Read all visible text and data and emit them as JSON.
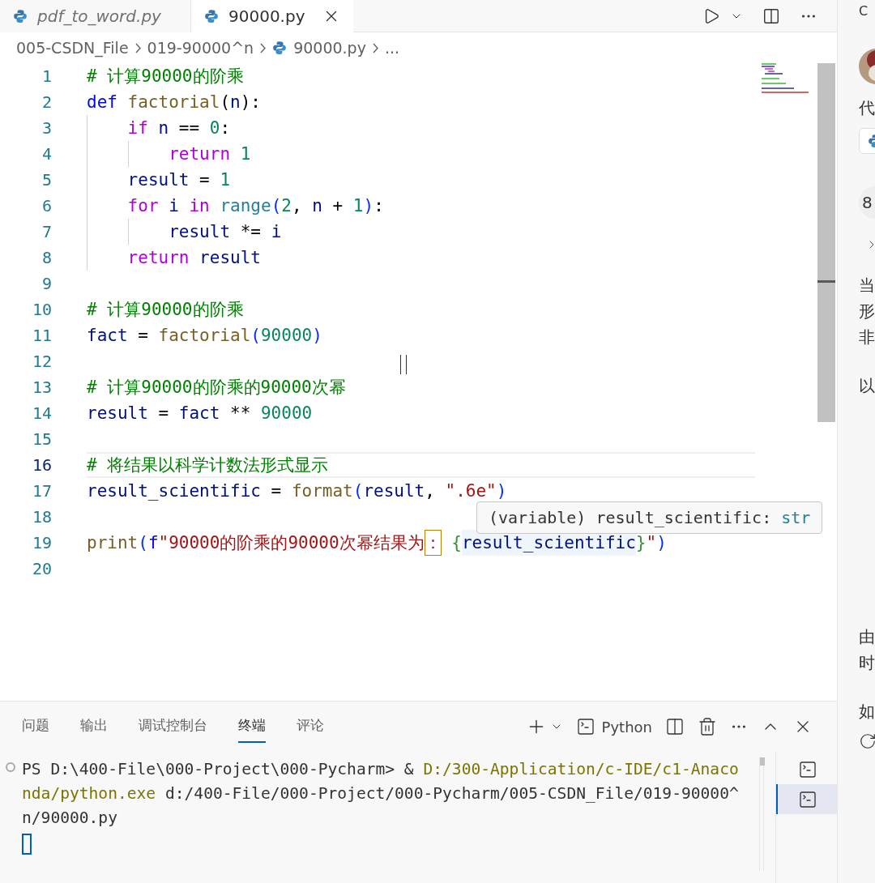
{
  "editor_tabs": [
    {
      "label": "pdf_to_word.py",
      "selected": false,
      "preview": true,
      "closable": false
    },
    {
      "label": "90000.py",
      "selected": true,
      "preview": false,
      "closable": true
    }
  ],
  "breadcrumbs": [
    {
      "label": "005-CSDN_File",
      "kind": "folder"
    },
    {
      "label": "019-90000^n",
      "kind": "folder"
    },
    {
      "label": "90000.py",
      "kind": "file"
    },
    {
      "label": "...",
      "kind": "more"
    }
  ],
  "code_lines": [
    {
      "number": "1",
      "current": false,
      "tokens": [
        {
          "kind": "comment",
          "text": "# 计算90000的阶乘"
        }
      ]
    },
    {
      "number": "2",
      "current": false,
      "tokens": [
        {
          "kind": "storage",
          "text": "def "
        },
        {
          "kind": "function",
          "text": "factorial"
        },
        {
          "kind": "plain",
          "text": "("
        },
        {
          "kind": "variable",
          "text": "n"
        },
        {
          "kind": "plain",
          "text": "):"
        }
      ]
    },
    {
      "number": "3",
      "current": false,
      "indent_guides": [
        {
          "visible": true
        }
      ],
      "tokens": [
        {
          "kind": "keyword",
          "text": "if "
        },
        {
          "kind": "variable",
          "text": "n"
        },
        {
          "kind": "plain",
          "text": " == "
        },
        {
          "kind": "number",
          "text": "0"
        },
        {
          "kind": "plain",
          "text": ":"
        }
      ]
    },
    {
      "number": "4",
      "current": false,
      "indent_guides": [
        {
          "visible": true
        },
        {
          "visible": true
        }
      ],
      "tokens": [
        {
          "kind": "keyword",
          "text": "return "
        },
        {
          "kind": "number",
          "text": "1"
        }
      ]
    },
    {
      "number": "5",
      "current": false,
      "indent_guides": [
        {
          "visible": true
        }
      ],
      "tokens": [
        {
          "kind": "variable",
          "text": "result"
        },
        {
          "kind": "plain",
          "text": " = "
        },
        {
          "kind": "number",
          "text": "1"
        }
      ]
    },
    {
      "number": "6",
      "current": false,
      "indent_guides": [
        {
          "visible": true
        }
      ],
      "tokens": [
        {
          "kind": "keyword",
          "text": "for "
        },
        {
          "kind": "variable",
          "text": "i"
        },
        {
          "kind": "keyword",
          "text": " in "
        },
        {
          "kind": "type",
          "text": "range"
        },
        {
          "kind": "bracket1",
          "text": "("
        },
        {
          "kind": "number",
          "text": "2"
        },
        {
          "kind": "plain",
          "text": ", "
        },
        {
          "kind": "variable",
          "text": "n"
        },
        {
          "kind": "plain",
          "text": " + "
        },
        {
          "kind": "number",
          "text": "1"
        },
        {
          "kind": "bracket1",
          "text": ")"
        },
        {
          "kind": "plain",
          "text": ":"
        }
      ]
    },
    {
      "number": "7",
      "current": false,
      "indent_guides": [
        {
          "visible": true
        },
        {
          "visible": true
        }
      ],
      "tokens": [
        {
          "kind": "variable",
          "text": "result"
        },
        {
          "kind": "plain",
          "text": " *= "
        },
        {
          "kind": "variable",
          "text": "i"
        }
      ]
    },
    {
      "number": "8",
      "current": false,
      "indent_guides": [
        {
          "visible": true
        }
      ],
      "tokens": [
        {
          "kind": "keyword",
          "text": "return "
        },
        {
          "kind": "variable",
          "text": "result"
        }
      ]
    },
    {
      "number": "9",
      "current": false
    },
    {
      "number": "10",
      "current": false,
      "tokens": [
        {
          "kind": "comment",
          "text": "# 计算90000的阶乘"
        }
      ]
    },
    {
      "number": "11",
      "current": false,
      "tokens": [
        {
          "kind": "variable",
          "text": "fact"
        },
        {
          "kind": "plain",
          "text": " = "
        },
        {
          "kind": "function",
          "text": "factorial"
        },
        {
          "kind": "bracket1",
          "text": "("
        },
        {
          "kind": "number",
          "text": "90000"
        },
        {
          "kind": "bracket1",
          "text": ")"
        }
      ]
    },
    {
      "number": "12",
      "current": false
    },
    {
      "number": "13",
      "current": false,
      "tokens": [
        {
          "kind": "comment",
          "text": "# 计算90000的阶乘的90000次幂"
        }
      ]
    },
    {
      "number": "14",
      "current": false,
      "tokens": [
        {
          "kind": "variable",
          "text": "result"
        },
        {
          "kind": "plain",
          "text": " = "
        },
        {
          "kind": "variable",
          "text": "fact"
        },
        {
          "kind": "plain",
          "text": " ** "
        },
        {
          "kind": "number",
          "text": "90000"
        }
      ]
    },
    {
      "number": "15",
      "current": false
    },
    {
      "number": "16",
      "current": true,
      "tokens": [
        {
          "kind": "comment",
          "text": "# 将结果以科学计数法形式显示"
        }
      ]
    },
    {
      "number": "17",
      "current": false,
      "tokens": [
        {
          "kind": "variable",
          "text": "result_scientific"
        },
        {
          "kind": "plain",
          "text": " = "
        },
        {
          "kind": "function",
          "text": "format"
        },
        {
          "kind": "bracket1",
          "text": "("
        },
        {
          "kind": "variable",
          "text": "result"
        },
        {
          "kind": "plain",
          "text": ", "
        },
        {
          "kind": "string",
          "text": "\".6e\""
        },
        {
          "kind": "bracket1",
          "text": ")"
        }
      ]
    },
    {
      "number": "18",
      "current": false
    },
    {
      "number": "19",
      "current": false,
      "tokens": [
        {
          "kind": "function",
          "text": "print"
        },
        {
          "kind": "bracket1",
          "text": "("
        },
        {
          "kind": "storage",
          "text": "f"
        },
        {
          "kind": "string",
          "text": "\"90000的阶乘的90000次幂结果为"
        },
        {
          "kind": "string-boxed",
          "text": "："
        },
        {
          "kind": "bracket2",
          "text": " {"
        },
        {
          "kind": "variable-highlight",
          "text": "result_scientific"
        },
        {
          "kind": "bracket2",
          "text": "}"
        },
        {
          "kind": "string",
          "text": "\""
        },
        {
          "kind": "bracket1",
          "text": ")"
        }
      ]
    },
    {
      "number": "20",
      "current": false
    }
  ],
  "hover_tooltip": {
    "signature": "(variable) result_scientific: ",
    "type": "str"
  },
  "panel_tabs": [
    {
      "label": "问题",
      "selected": false
    },
    {
      "label": "输出",
      "selected": false
    },
    {
      "label": "调试控制台",
      "selected": false
    },
    {
      "label": "终端",
      "selected": true
    },
    {
      "label": "评论",
      "selected": false
    }
  ],
  "terminal_profile": "Python",
  "terminal_lines": [
    [
      {
        "kind": "plain",
        "text": "PS D:\\400-File\\000-Project\\000-Pycharm> & "
      },
      {
        "kind": "path",
        "text": "D:/300-Application/c-IDE/c1-Anaco"
      }
    ],
    [
      {
        "kind": "path",
        "text": "nda/python.exe"
      },
      {
        "kind": "plain",
        "text": " d:/400-File/000-Project/000-Pycharm/005-CSDN_File/019-90000^"
      }
    ],
    [
      {
        "kind": "plain",
        "text": "n/90000.py"
      }
    ]
  ],
  "terminal_instances": [
    {
      "selected": false
    },
    {
      "selected": true
    }
  ],
  "side_panel": {
    "top_text": "C",
    "title_char": "代",
    "badge_text": "8",
    "paragraph_chars": [
      "当",
      "形",
      "非"
    ],
    "line_chars": [
      "以"
    ],
    "lower_chars": [
      "由",
      "时"
    ],
    "bottom_chars": [
      "如"
    ]
  }
}
